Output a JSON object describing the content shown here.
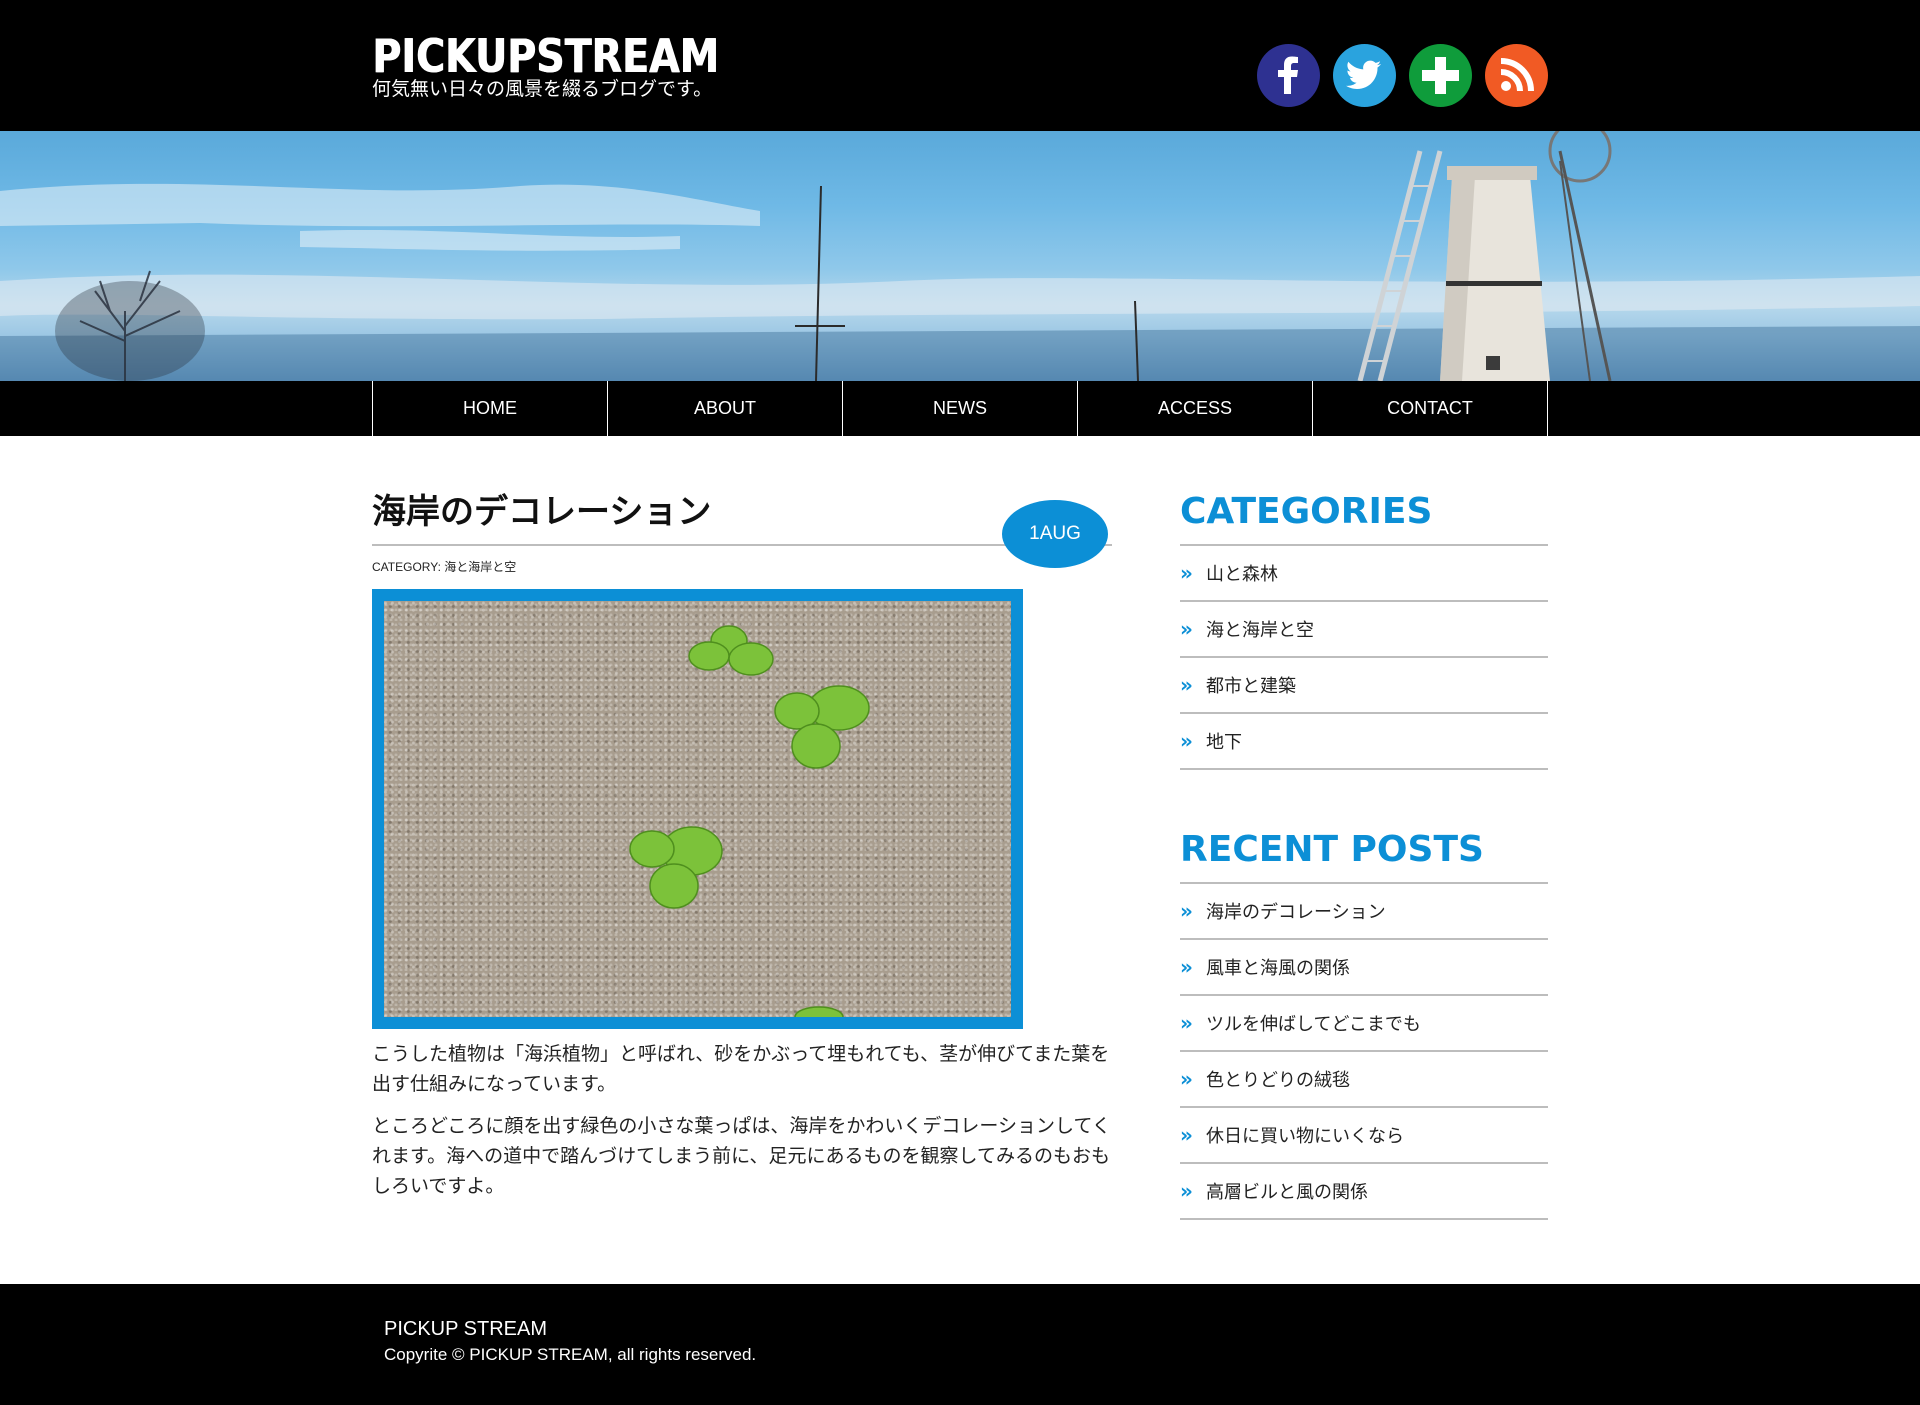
{
  "header": {
    "logo": "PICKUPSTREAM",
    "tagline": "何気無い日々の風景を綴るブログです。",
    "social": [
      {
        "name": "facebook-icon",
        "color": "#2e3191"
      },
      {
        "name": "twitter-icon",
        "color": "#2aa3de"
      },
      {
        "name": "plus-icon",
        "color": "#0f9c3b"
      },
      {
        "name": "rss-icon",
        "color": "#f15a24"
      }
    ]
  },
  "nav": {
    "items": [
      "HOME",
      "ABOUT",
      "NEWS",
      "ACCESS",
      "CONTACT"
    ]
  },
  "article": {
    "title": "海岸のデコレーション",
    "date": "1AUG",
    "category_label": "CATEGORY:",
    "category_value": "海と海岸と空",
    "paragraphs": [
      "こうした植物は「海浜植物」と呼ばれ、砂をかぶって埋もれても、茎が伸びてまた葉を出す仕組みになっています。",
      "ところどころに顔を出す緑色の小さな葉っぱは、海岸をかわいくデコレーションしてくれます。海への道中で踏んづけてしまう前に、足元にあるものを観察してみるのもおもしろいですよ。"
    ]
  },
  "sidebar": {
    "categories_title": "CATEGORIES",
    "categories": [
      "山と森林",
      "海と海岸と空",
      "都市と建築",
      "地下"
    ],
    "recent_title": "RECENT POSTS",
    "recent": [
      "海岸のデコレーション",
      "風車と海風の関係",
      "ツルを伸ばしてどこまでも",
      "色とりどりの絨毯",
      "休日に買い物にいくなら",
      "高層ビルと風の関係"
    ]
  },
  "footer": {
    "name": "PICKUP STREAM",
    "copyright": "Copyrite © PICKUP STREAM, all rights reserved."
  },
  "colors": {
    "accent": "#0c8fd6",
    "header_bg": "#000000"
  }
}
